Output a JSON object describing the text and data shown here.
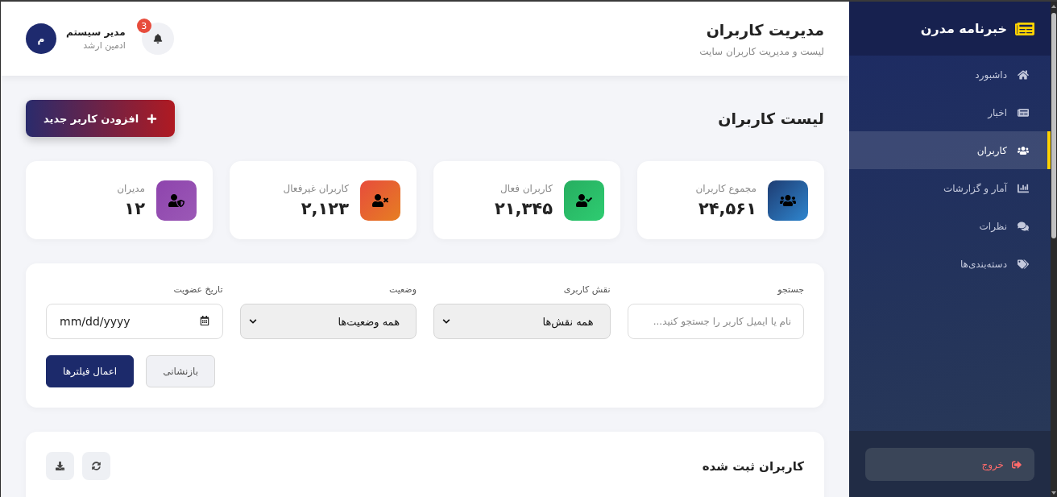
{
  "sidebar": {
    "brand": "خبرنامه مدرن",
    "items": [
      {
        "label": "داشبورد",
        "selected": false
      },
      {
        "label": "اخبار",
        "selected": false
      },
      {
        "label": "کاربران",
        "selected": true
      },
      {
        "label": "آمار و گزارشات",
        "selected": false
      },
      {
        "label": "نظرات",
        "selected": false
      },
      {
        "label": "دسته‌بندی‌ها",
        "selected": false
      }
    ],
    "logout": "خروج"
  },
  "header": {
    "title": "مدیریت کاربران",
    "subtitle": "لیست و مدیریت کاربران سایت",
    "notifications": "3",
    "user": {
      "name": "مدیر سیستم",
      "role": "ادمین ارشد",
      "initial": "م"
    }
  },
  "page": {
    "title": "لیست کاربران",
    "add_button": "افزودن کاربر جدید"
  },
  "stats": [
    {
      "label": "مجموع کاربران",
      "value": "۲۴,۵۶۱"
    },
    {
      "label": "کاربران فعال",
      "value": "۲۱,۳۴۵"
    },
    {
      "label": "کاربران غیرفعال",
      "value": "۲,۱۲۳"
    },
    {
      "label": "مدیران",
      "value": "۱۲"
    }
  ],
  "filters": {
    "fields": [
      {
        "kind": "search",
        "label": "جستجو",
        "placeholder": "نام یا ایمیل کاربر را جستجو کنید..."
      },
      {
        "kind": "select",
        "label": "نقش کاربری",
        "value": "همه نقش‌ها"
      },
      {
        "kind": "select",
        "label": "وضعیت",
        "value": "همه وضعیت‌ها"
      },
      {
        "kind": "date",
        "label": "تاریخ عضویت",
        "placeholder": "mm/dd/yyyy"
      }
    ],
    "buttons": [
      {
        "kind": "reset",
        "label": "بازنشانی"
      },
      {
        "kind": "apply",
        "label": "اعمال فیلترها"
      }
    ]
  },
  "table": {
    "title": "کاربران ثبت شده"
  }
}
